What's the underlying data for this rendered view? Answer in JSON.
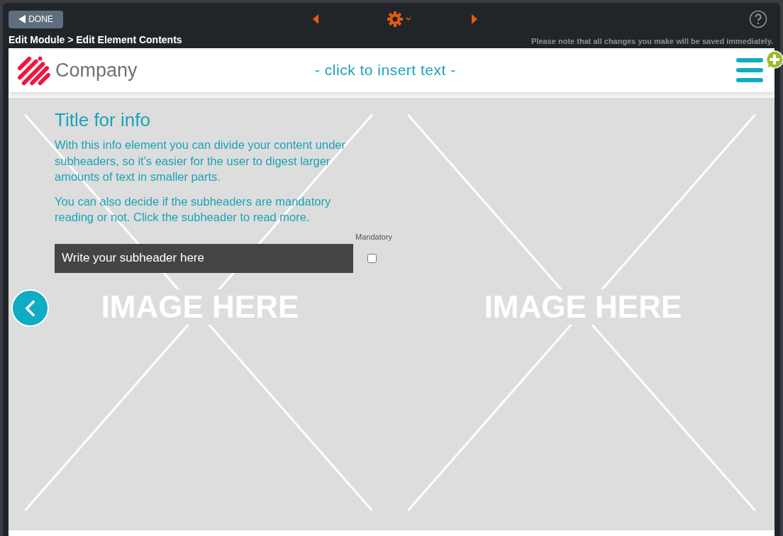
{
  "toolbar": {
    "done_button": "DONE",
    "breadcrumb": "Edit Module > Edit Element Contents",
    "note": "Please note that all changes you make will be saved immediately."
  },
  "header": {
    "logo_text": "Company",
    "insert_text": "- click to insert text -"
  },
  "images": [
    {
      "label": "IMAGE HERE"
    },
    {
      "label": "IMAGE HERE"
    }
  ],
  "info": {
    "title": "Title for info",
    "paragraphs": [
      "With this info element you can divide your content under subheaders, so it's easier for the user to digest larger amounts of text in smaller parts.",
      "You can also decide if the subheaders are mandatory reading or not. Click the subheader to read more."
    ],
    "mandatory_label": "Mandatory",
    "subheader": "Write your subheader here",
    "mandatory": false
  }
}
